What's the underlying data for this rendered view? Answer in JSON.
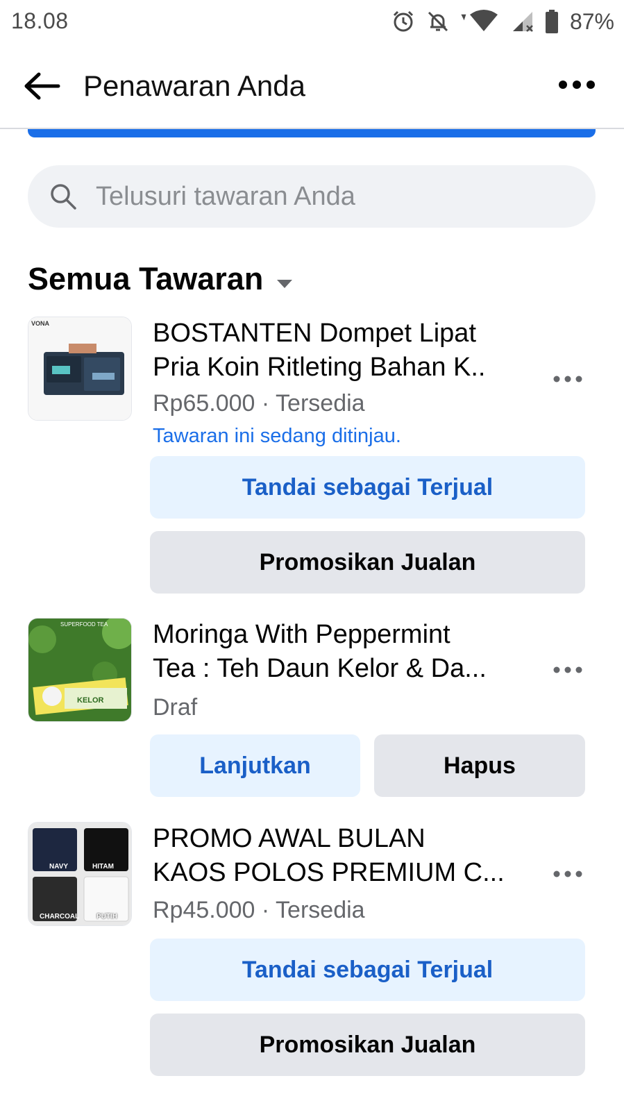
{
  "status_bar": {
    "time": "18.08",
    "battery": "87%",
    "icons": [
      "alarm-icon",
      "mute-icon",
      "wifi-icon",
      "signal-icon",
      "battery-icon"
    ]
  },
  "header": {
    "title": "Penawaran Anda",
    "icons": [
      "back-arrow-icon",
      "more-options-icon"
    ]
  },
  "search": {
    "placeholder": "Telusuri tawaran Anda"
  },
  "section": {
    "title": "Semua Tawaran"
  },
  "listings": [
    {
      "title_line1": "BOSTANTEN Dompet Lipat",
      "title_line2": "Pria Koin Ritleting Bahan K..",
      "price_status": "Rp65.000 · Tersedia",
      "review_note": "Tawaran ini sedang ditinjau.",
      "primary_action": "Tandai sebagai Terjual",
      "secondary_action": "Promosikan Jualan",
      "thumb_brand": "VONA"
    },
    {
      "title_line1": "Moringa With Peppermint",
      "title_line2": "Tea : Teh Daun Kelor & Da...",
      "status": "Draf",
      "primary_action": "Lanjutkan",
      "secondary_action": "Hapus",
      "thumb_top": "SUPERFOOD TEA",
      "thumb_brand": "KELOR"
    },
    {
      "title_line1": "PROMO AWAL BULAN",
      "title_line2": "KAOS POLOS PREMIUM C...",
      "price_status": "Rp45.000 · Tersedia",
      "primary_action": "Tandai sebagai Terjual",
      "secondary_action": "Promosikan Jualan",
      "thumb_labels": [
        "NAVY",
        "HITAM",
        "CHARCOAL",
        "PUTIH"
      ]
    }
  ],
  "colors": {
    "accent": "#1a6ee8",
    "button_blue_bg": "#e7f3ff",
    "button_gray_bg": "#e4e6eb"
  }
}
